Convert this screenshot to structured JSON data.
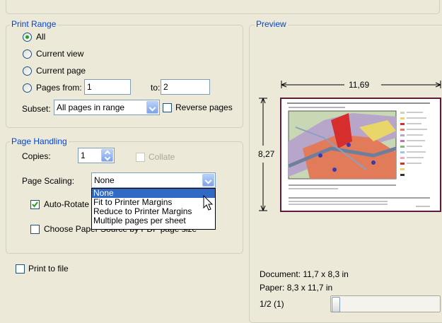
{
  "print_range": {
    "title": "Print Range",
    "options": [
      "All",
      "Current view",
      "Current page",
      "Pages from:"
    ],
    "selected_index": 0,
    "pages_from": "1",
    "to_label": "to:",
    "pages_to": "2",
    "subset_label": "Subset:",
    "subset_value": "All pages in range",
    "reverse_pages_label": "Reverse pages",
    "reverse_pages_checked": false
  },
  "page_handling": {
    "title": "Page Handling",
    "copies_label": "Copies:",
    "copies_value": "1",
    "collate_label": "Collate",
    "page_scaling_label": "Page Scaling:",
    "page_scaling_value": "None",
    "scaling_options": [
      "None",
      "Fit to Printer Margins",
      "Reduce to Printer Margins",
      "Multiple pages per sheet"
    ],
    "auto_rotate_label": "Auto-Rotate",
    "auto_rotate_checked": true,
    "choose_paper_label": "Choose Paper Source by PDF page size",
    "choose_paper_checked": false
  },
  "print_to_file": {
    "label": "Print to file",
    "checked": false
  },
  "preview": {
    "title": "Preview",
    "width_dimension": "11,69",
    "height_dimension": "8,27",
    "document_size": "Document: 11,7 x 8,3 in",
    "paper_size": "Paper: 8,3 x 11,7 in",
    "page_indicator": "1/2 (1)"
  },
  "colors": {
    "group_title": "#0046d5",
    "selection": "#316ac5",
    "window_bg": "#ece9d8"
  }
}
